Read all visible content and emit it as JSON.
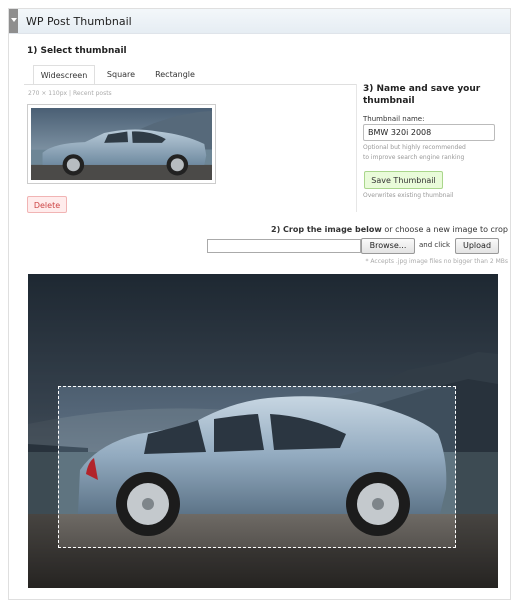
{
  "panel": {
    "title": "WP Post Thumbnail"
  },
  "select": {
    "heading": "1) Select thumbnail",
    "tabs": [
      {
        "label": "Widescreen",
        "active": true
      },
      {
        "label": "Square",
        "active": false
      },
      {
        "label": "Rectangle",
        "active": false
      }
    ],
    "meta": "270 × 110px | Recent posts",
    "delete_label": "Delete"
  },
  "save": {
    "heading_line1": "3) Name and save your",
    "heading_line2": "thumbnail",
    "name_label": "Thumbnail name:",
    "name_value": "BMW 320i 2008",
    "hint_line1": "Optional but highly recommended",
    "hint_line2": "to improve search engine ranking",
    "save_label": "Save Thumbnail",
    "overwrite_note": "Overwrites existing thumbnail"
  },
  "crop": {
    "heading_bold": "2) Crop the image below",
    "heading_rest": " or choose a new image to crop",
    "browse_label": "Browse...",
    "and_click": "and click",
    "upload_label": "Upload",
    "accepts": "* Accepts .jpg image files no bigger than 2 MBs"
  },
  "icons": {
    "handle": "chevron-down-icon"
  },
  "colors": {
    "save_bg": "#e9fbd9",
    "delete_bg": "#ffecec",
    "header_bg": "#e6edf3"
  }
}
